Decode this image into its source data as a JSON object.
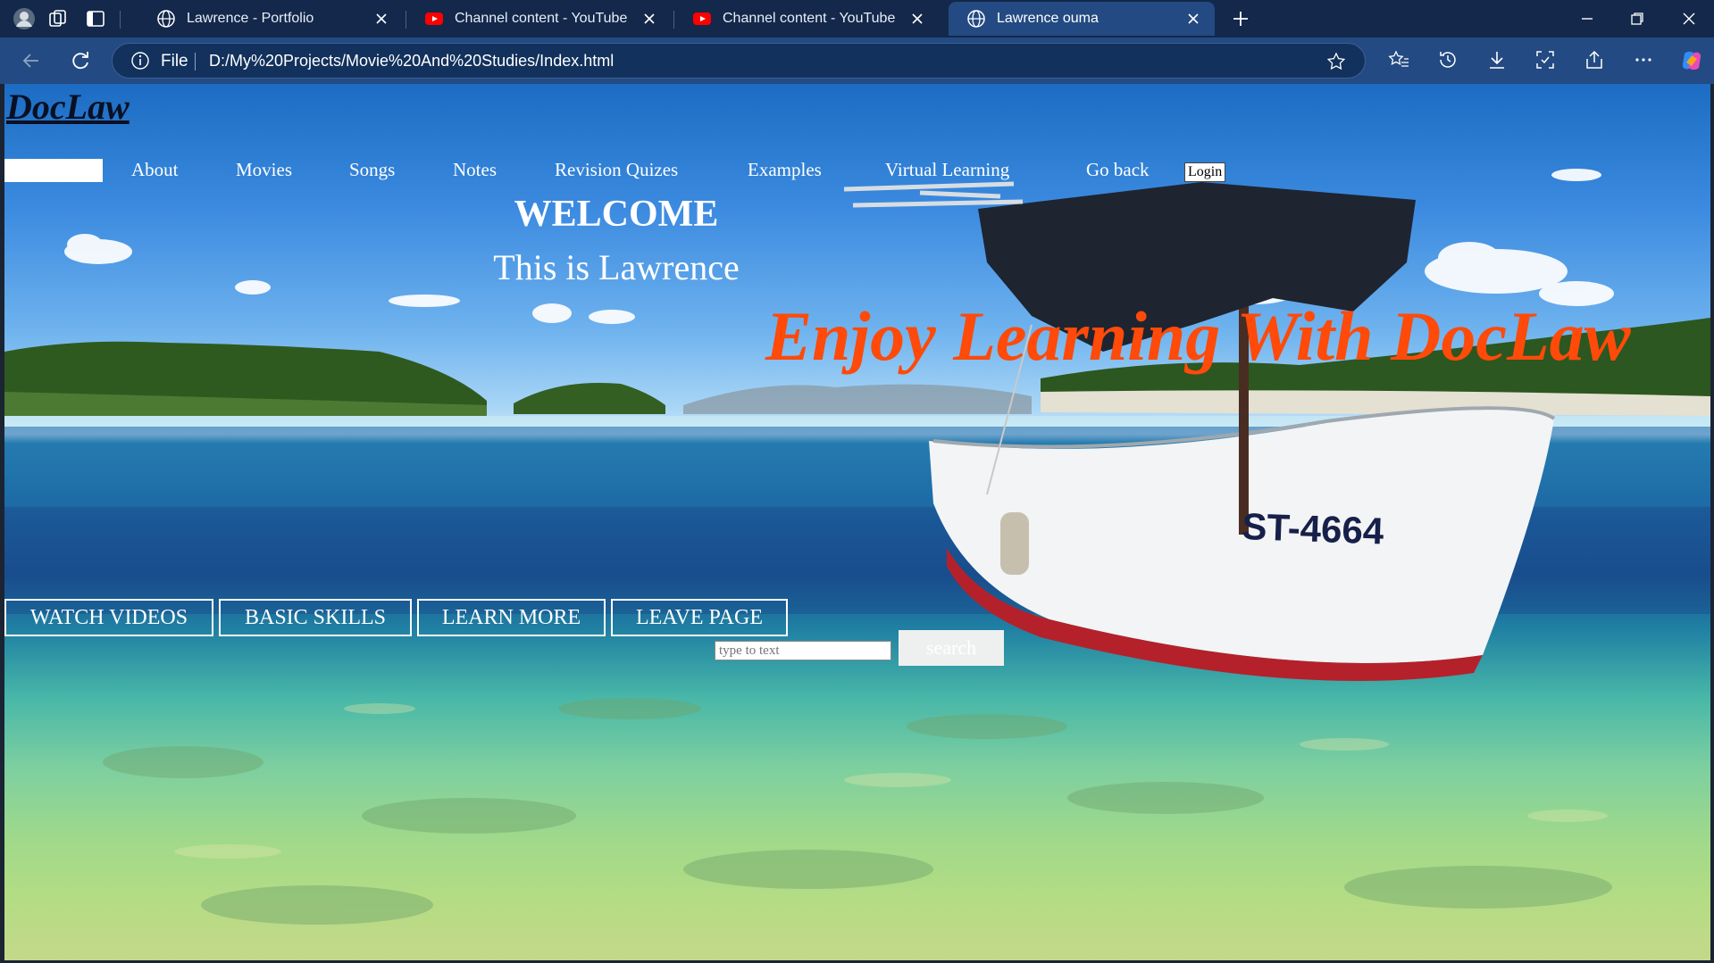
{
  "browser": {
    "tabs": [
      {
        "title": "Lawrence - Portfolio",
        "favicon": "globe-icon",
        "active": false
      },
      {
        "title": "Channel content - YouTube Studio",
        "favicon": "youtube-icon",
        "active": false
      },
      {
        "title": "Channel content - YouTube Studio",
        "favicon": "youtube-icon",
        "active": false
      },
      {
        "title": "Lawrence ouma",
        "favicon": "globe-icon",
        "active": true
      }
    ],
    "address": {
      "scheme_label": "File",
      "url": "D:/My%20Projects/Movie%20And%20Studies/Index.html"
    }
  },
  "site": {
    "logo": "DocLaw",
    "nav": [
      "About",
      "Movies",
      "Songs",
      "Notes",
      "Revision Quizes",
      "Examples",
      "Virtual Learning",
      "Go back"
    ],
    "login_label": "Login",
    "welcome": "WELCOME",
    "subtitle": "This is Lawrence",
    "tagline": "Enjoy Learning With DocLaw",
    "buttons": [
      "WATCH VIDEOS",
      "BASIC SKILLS",
      "LEARN MORE",
      "LEAVE PAGE"
    ],
    "search": {
      "placeholder": "type to text",
      "button_label": "search"
    },
    "boat_label": "ST-4664"
  },
  "colors": {
    "tagline": "#ff4a0a",
    "chrome_dark": "#13284a",
    "chrome_active": "#234a82"
  }
}
